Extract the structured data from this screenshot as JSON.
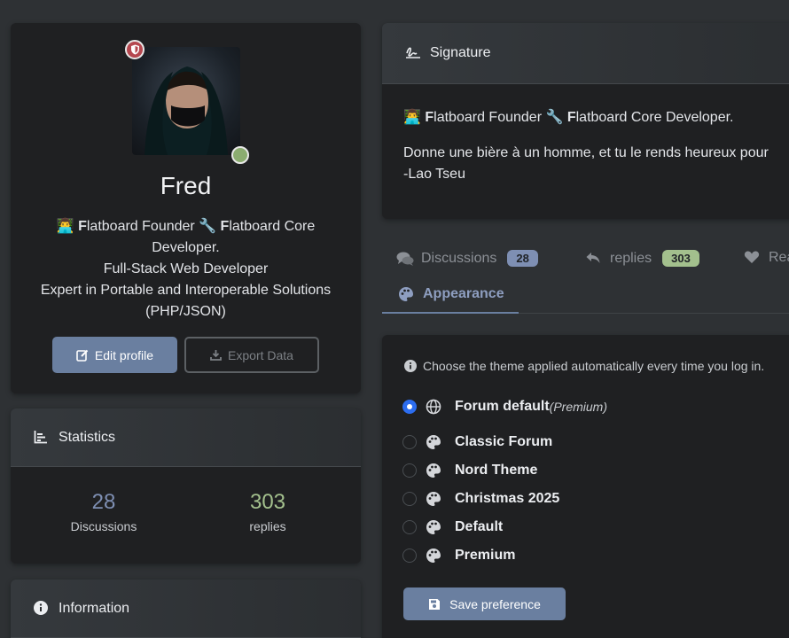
{
  "profile": {
    "username": "Fred",
    "bio_line1_prefix": "👨‍💻 ",
    "bio_line1_F1": "F",
    "bio_line1_mid": "latboard Founder 🔧 ",
    "bio_line1_F2": "F",
    "bio_line1_rest": "latboard Core Developer.",
    "bio_line2": "Full-Stack Web Developer",
    "bio_line3": "Expert in Portable and Interoperable Solutions (PHP/JSON)",
    "edit_label": "Edit profile",
    "export_label": "Export Data"
  },
  "statistics": {
    "title": "Statistics",
    "discussions_count": "28",
    "discussions_label": "Discussions",
    "replies_count": "303",
    "replies_label": "replies"
  },
  "information": {
    "title": "Information"
  },
  "signature": {
    "title": "Signature",
    "line1_prefix": "👨‍💻 ",
    "line1_F1": "F",
    "line1_mid": "latboard Founder 🔧 ",
    "line1_F2": "F",
    "line1_rest": "latboard Core Developer.",
    "quote": "Donne une bière à un homme, et tu le rends heureux pour",
    "author": "-Lao Tseu"
  },
  "tabs": {
    "discussions_label": "Discussions",
    "discussions_count": "28",
    "replies_label": "replies",
    "replies_count": "303",
    "reactions_label": "Rea",
    "appearance_label": "Appearance"
  },
  "appearance": {
    "hint": "Choose the theme applied automatically every time you log in.",
    "themes": [
      {
        "label": "Forum default",
        "note": "(Premium)",
        "selected": true
      },
      {
        "label": "Classic Forum"
      },
      {
        "label": "Nord Theme"
      },
      {
        "label": "Christmas 2025"
      },
      {
        "label": "Default"
      },
      {
        "label": "Premium"
      }
    ],
    "save_label": "Save preference"
  },
  "colors": {
    "accent": "#6a7fa0",
    "discussions_badge": "#7e8fb3",
    "replies_badge": "#a3c08d",
    "online": "#8bac70",
    "moderator_badge": "#b5474f",
    "radio_selected": "#2c6df0"
  }
}
